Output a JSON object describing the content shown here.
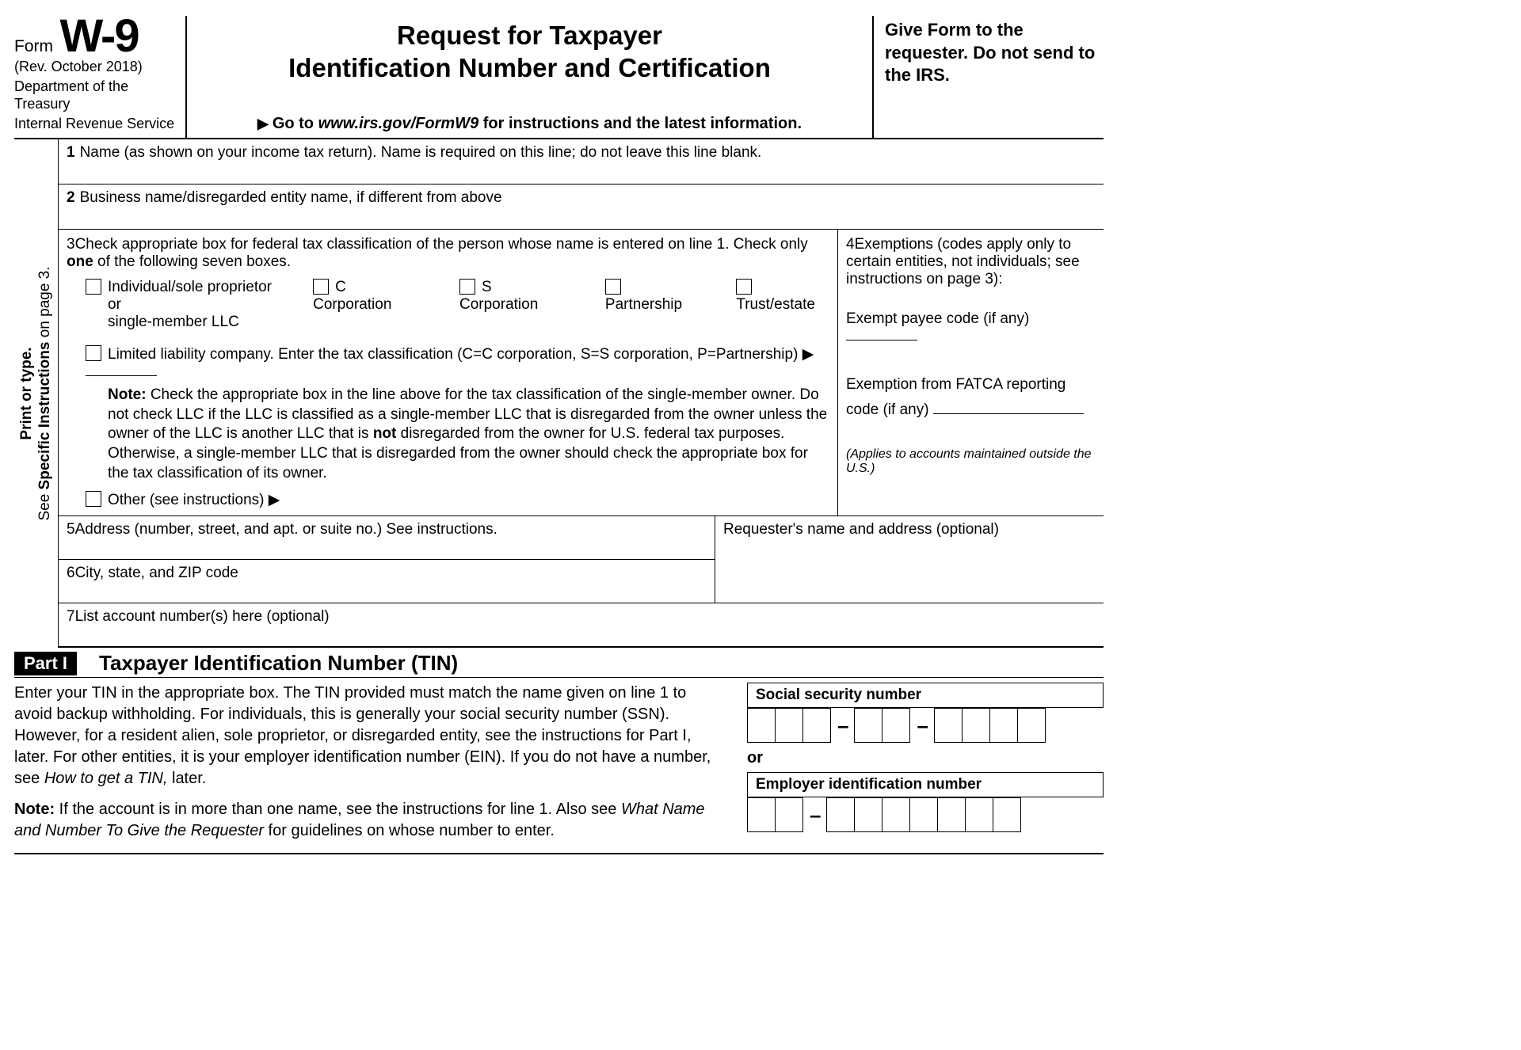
{
  "header": {
    "form_word": "Form",
    "form_code": "W-9",
    "revision": "(Rev. October 2018)",
    "dept1": "Department of the Treasury",
    "dept2": "Internal Revenue Service",
    "title_line1": "Request for Taxpayer",
    "title_line2": "Identification Number and Certification",
    "goto_prefix": "Go to ",
    "goto_url": "www.irs.gov/FormW9",
    "goto_suffix": " for instructions and the latest information.",
    "right_text": "Give Form to the requester. Do not send to the IRS."
  },
  "side_label": {
    "line1": "Print or type.",
    "line2_a": "See ",
    "line2_b": "Specific Instructions",
    "line2_c": " on page 3."
  },
  "lines": {
    "l1_num": "1",
    "l1": "Name (as shown on your income tax return). Name is required on this line; do not leave this line blank.",
    "l2_num": "2",
    "l2": "Business name/disregarded entity name, if different from above",
    "l3_num": "3",
    "l3_a": "Check appropriate box for federal tax classification of the person whose name is entered on line 1. Check only ",
    "l3_b": "one",
    "l3_c": " of the following seven boxes.",
    "cb_indiv_a": "Individual/sole proprietor or",
    "cb_indiv_b": "single-member LLC",
    "cb_ccorp": "C Corporation",
    "cb_scorp": "S Corporation",
    "cb_part": "Partnership",
    "cb_trust": "Trust/estate",
    "cb_llc": "Limited liability company. Enter the tax classification (C=C corporation, S=S corporation, P=Partnership) ▶",
    "llc_note_label": "Note: ",
    "llc_note_a": "Check the appropriate box in the line above for the tax classification of the single-member owner.  Do not check LLC if the LLC is classified as a single-member LLC that is disregarded from the owner unless the owner of the LLC is another LLC that is ",
    "llc_note_b": "not",
    "llc_note_c": " disregarded from the owner for U.S. federal tax purposes. Otherwise, a single-member LLC that is disregarded from the owner should check the appropriate box for the tax classification of its owner.",
    "cb_other": "Other (see instructions) ▶",
    "l4_num": "4",
    "l4": "Exemptions (codes apply only to certain entities, not individuals; see instructions on page 3):",
    "l4_payee": "Exempt payee code (if any)",
    "l4_fatca_a": "Exemption from FATCA reporting",
    "l4_fatca_b": "code (if any)",
    "l4_applies": "(Applies to accounts maintained outside the U.S.)",
    "l5_num": "5",
    "l5": "Address (number, street, and apt. or suite no.) See instructions.",
    "l6_num": "6",
    "l6": "City, state, and ZIP code",
    "requester": "Requester's name and address (optional)",
    "l7_num": "7",
    "l7": "List account number(s) here (optional)"
  },
  "part1": {
    "tag": "Part I",
    "title": "Taxpayer Identification Number (TIN)",
    "p1_a": "Enter your TIN in the appropriate box. The TIN provided must match the name given on line 1 to avoid backup withholding. For individuals, this is generally your social security number (SSN). However, for a resident alien, sole proprietor, or disregarded entity, see the instructions for Part I, later. For other entities, it is your employer identification number (EIN). If you do not have a number, see ",
    "p1_b": "How to get a TIN,",
    "p1_c": " later.",
    "p2_label": "Note:",
    "p2_a": " If the account is in more than one name, see the instructions for line 1. Also see ",
    "p2_b": "What Name and Number To Give the Requester",
    "p2_c": " for guidelines on whose number to enter.",
    "ssn_label": "Social security number",
    "or": "or",
    "ein_label": "Employer identification number",
    "dash": "–"
  }
}
